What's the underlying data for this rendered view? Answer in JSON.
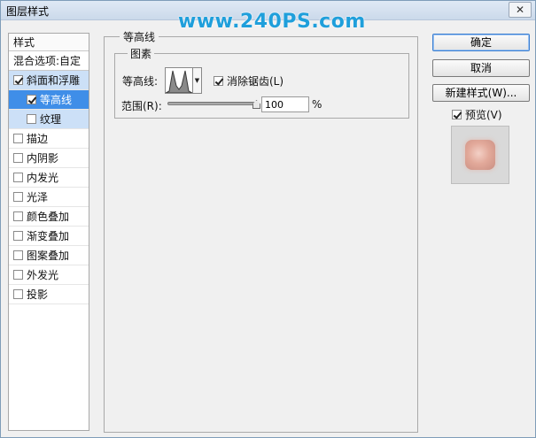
{
  "window": {
    "title": "图层样式",
    "close_label": "✕",
    "watermark": "www.240PS.com"
  },
  "style_list": {
    "header": "样式",
    "blend_options": "混合选项:自定",
    "items": [
      {
        "label": "斜面和浮雕",
        "checked": true
      },
      {
        "label": "等高线",
        "checked": true
      },
      {
        "label": "纹理",
        "checked": false
      },
      {
        "label": "描边",
        "checked": false
      },
      {
        "label": "内阴影",
        "checked": false
      },
      {
        "label": "内发光",
        "checked": false
      },
      {
        "label": "光泽",
        "checked": false
      },
      {
        "label": "颜色叠加",
        "checked": false
      },
      {
        "label": "渐变叠加",
        "checked": false
      },
      {
        "label": "图案叠加",
        "checked": false
      },
      {
        "label": "外发光",
        "checked": false
      },
      {
        "label": "投影",
        "checked": false
      }
    ]
  },
  "contour_panel": {
    "group_title": "等高线",
    "subgroup_title": "图素",
    "contour_label": "等高线:",
    "anti_alias_label": "消除锯齿(L)",
    "anti_alias_checked": true,
    "range_label": "范围(R):",
    "range_value": "100",
    "range_unit": "%",
    "dropdown_arrow": "▼"
  },
  "buttons": {
    "ok": "确定",
    "cancel": "取消",
    "new_style": "新建样式(W)...",
    "preview_label": "预览(V)",
    "preview_checked": true
  }
}
